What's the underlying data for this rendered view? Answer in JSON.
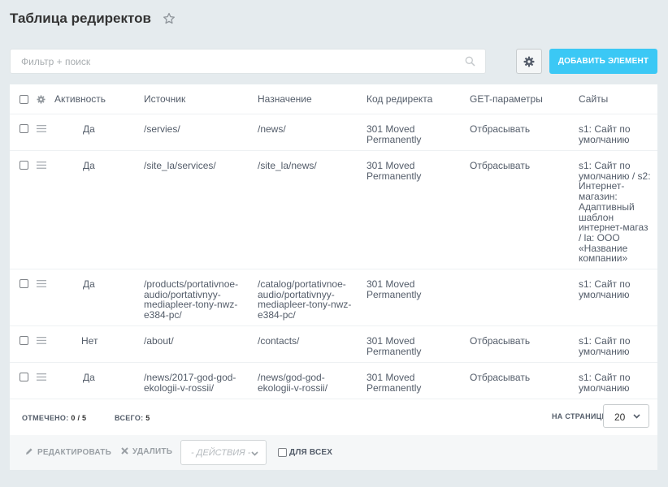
{
  "header": {
    "title": "Таблица редиректов",
    "favorite_icon": "star-outline-icon"
  },
  "toolbar": {
    "filter_placeholder": "Фильтр + поиск",
    "search_icon": "search-icon",
    "settings_icon": "gear-icon",
    "add_label": "ДОБАВИТЬ ЭЛЕМЕНТ",
    "accent_color": "#3bc8f5"
  },
  "table": {
    "columns": [
      "Активность",
      "Источник",
      "Назначение",
      "Код редиректа",
      "GET-параметры",
      "Сайты"
    ],
    "rows": [
      {
        "active": "Да",
        "source": "/servies/",
        "target": "/news/",
        "code": "301 Moved\nPermanently",
        "get": "Отбрасывать",
        "sites": "s1: Сайт по\nумолчанию"
      },
      {
        "active": "Да",
        "source": "/site_la/services/",
        "target": "/site_la/news/",
        "code": "301 Moved\nPermanently",
        "get": "Отбрасывать",
        "sites": "s1: Сайт по\nумолчанию / s2:\nИнтернет-\nмагазин:\nАдаптивный\nшаблон\nинтернет-магаз\n/ la: ООО\n«Название\nкомпании»"
      },
      {
        "active": "Да",
        "source": "/products/portativnoe-\naudio/portativnyy-\nmediapleer-tony-nwz-\ne384-pc/",
        "target": "/catalog/portativnoe-\naudio/portativnyy-\nmediapleer-tony-nwz-\ne384-pc/",
        "code": "301 Moved\nPermanently",
        "get": "",
        "sites": "s1: Сайт по\nумолчанию"
      },
      {
        "active": "Нет",
        "source": "/about/",
        "target": "/contacts/",
        "code": "301 Moved\nPermanently",
        "get": "Отбрасывать",
        "sites": "s1: Сайт по\nумолчанию"
      },
      {
        "active": "Да",
        "source": "/news/2017-god-god-\nekologii-v-rossii/",
        "target": "/news/god-god-\nekologii-v-rossii/",
        "code": "301 Moved\nPermanently",
        "get": "Отбрасывать",
        "sites": "s1: Сайт по\nумолчанию"
      }
    ]
  },
  "footer": {
    "selected_label": "ОТМЕЧЕНО:",
    "selected_value": "0 / 5",
    "total_label": "ВСЕГО:",
    "total_value": "5",
    "per_page_label": "НА СТРАНИЦЕ:",
    "per_page_value": "20"
  },
  "actions": {
    "edit_label": "РЕДАКТИРОВАТЬ",
    "delete_label": "УДАЛИТЬ",
    "actions_select": "- ДЕЙСТВИЯ -",
    "for_all_label": "ДЛЯ ВСЕХ"
  }
}
